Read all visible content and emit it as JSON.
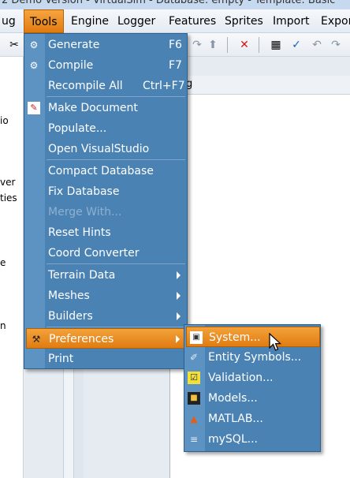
{
  "titlebar": {
    "text": "2 Demo Version - VirtualSim - Database: empty - Template: Basic"
  },
  "menubar": {
    "items": [
      "ug",
      "Tools",
      "Engine",
      "Logger",
      "Features",
      "Sprites",
      "Import",
      "Expor"
    ]
  },
  "toolbar": {
    "icons": [
      "cut-icon",
      "up-arrow-icon",
      "delete-icon",
      "properties-icon",
      "check-icon",
      "undo-icon",
      "redo-icon"
    ]
  },
  "left_panel": {
    "fragments": [
      "io",
      "ver",
      "ties",
      "e",
      "n"
    ]
  },
  "document": {
    "tab_fragment": "g"
  },
  "tools_menu": {
    "items": [
      {
        "label": "Generate",
        "shortcut": "F6",
        "icon": "generate-icon"
      },
      {
        "label": "Compile",
        "shortcut": "F7",
        "icon": "compile-icon"
      },
      {
        "label": "Recompile All",
        "shortcut": "Ctrl+F7"
      },
      {
        "label": "Make Document",
        "icon": "document-icon"
      },
      {
        "label": "Populate..."
      },
      {
        "label": "Open VisualStudio"
      },
      {
        "label": "Compact Database"
      },
      {
        "label": "Fix Database"
      },
      {
        "label": "Merge With...",
        "disabled": true
      },
      {
        "label": "Reset Hints"
      },
      {
        "label": "Coord Converter"
      },
      {
        "label": "Terrain Data",
        "submenu": true
      },
      {
        "label": "Meshes",
        "submenu": true
      },
      {
        "label": "Builders",
        "submenu": true
      },
      {
        "label": "Preferences",
        "submenu": true,
        "highlighted": true,
        "icon": "tools-icon"
      },
      {
        "label": "Print"
      }
    ]
  },
  "preferences_submenu": {
    "items": [
      {
        "label": "System...",
        "highlighted": true,
        "icon": "system-icon"
      },
      {
        "label": "Entity Symbols...",
        "icon": "entity-symbols-icon"
      },
      {
        "label": "Validation...",
        "icon": "validation-icon"
      },
      {
        "label": "Models...",
        "icon": "models-icon"
      },
      {
        "label": "MATLAB...",
        "icon": "matlab-icon"
      },
      {
        "label": "mySQL...",
        "icon": "mysql-icon"
      }
    ]
  },
  "colors": {
    "menu_bg": "#4a82b4",
    "highlight": "#e8891f",
    "menu_text": "#ffffff",
    "disabled_text": "#8fb0cf"
  }
}
